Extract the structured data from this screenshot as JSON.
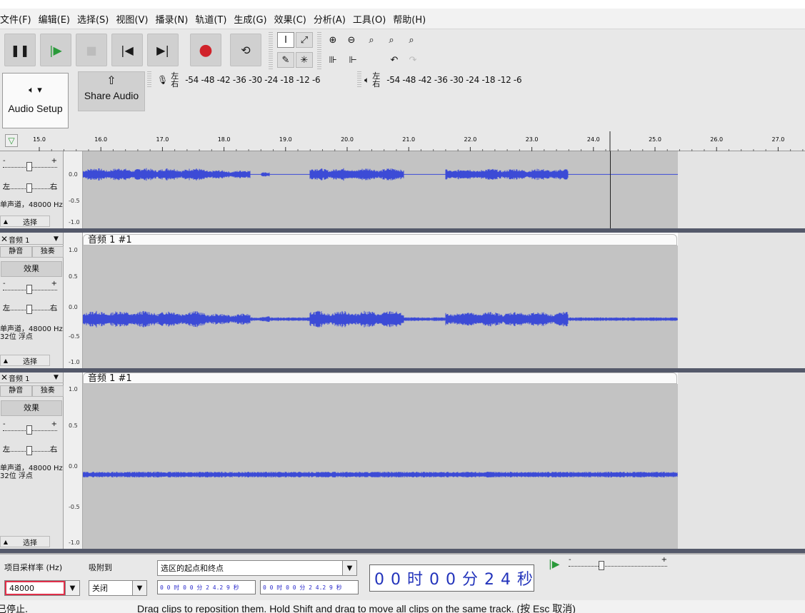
{
  "menu": [
    "文件(F)",
    "编辑(E)",
    "选择(S)",
    "视图(V)",
    "播录(N)",
    "轨道(T)",
    "生成(G)",
    "效果(C)",
    "分析(A)",
    "工具(O)",
    "帮助(H)"
  ],
  "transport": {
    "pause_icon": "pause-icon",
    "play_icon": "play-icon",
    "stop_icon": "stop-icon",
    "skip_start_icon": "skip-to-start-icon",
    "skip_end_icon": "skip-to-end-icon",
    "record_icon": "record-icon",
    "loop_icon": "loop-icon"
  },
  "audio_setup": {
    "label": "Audio Setup"
  },
  "share_audio": {
    "label": "Share Audio"
  },
  "meters": {
    "lr": "左右",
    "scale": "-54 -48 -42 -36 -30 -24 -18 -12 -6"
  },
  "ruler": {
    "ticks": [
      "15.0",
      "16.0",
      "17.0",
      "18.0",
      "19.0",
      "20.0",
      "21.0",
      "22.0",
      "23.0",
      "24.0",
      "25.0",
      "26.0",
      "27.0"
    ]
  },
  "track_common": {
    "left": "左",
    "right": "右",
    "select": "选择",
    "mute": "静音",
    "solo": "独奏",
    "effects": "效果",
    "plus": "+",
    "minus": "-"
  },
  "track0": {
    "info": "单声道，48000 Hz",
    "scale": [
      "0.0",
      "-0.5",
      "-1.0"
    ]
  },
  "track1": {
    "name": "音频 1",
    "clip": "音频 1 #1",
    "info1": "单声道，48000 Hz",
    "info2": "32位 浮点",
    "scale": [
      "1.0",
      "0.5",
      "0.0",
      "-0.5",
      "-1.0"
    ]
  },
  "track2": {
    "name": "音频 1",
    "clip": "音频 1 #1",
    "info1": "单声道，48000 Hz",
    "info2": "32位 浮点",
    "scale": [
      "1.0",
      "0.5",
      "0.0",
      "-0.5",
      "-1.0"
    ]
  },
  "bottom": {
    "rate_label": "项目采样率 (Hz)",
    "rate_value": "48000",
    "snap_label": "吸附到",
    "snap_value": "关闭",
    "selection_label": "选区的起点和终点",
    "time_start": "0 0 时 0 0 分 2 4.2 9 秒",
    "time_end": "0 0 时 0 0 分 2 4.2 9 秒",
    "big_time": "0 0 时 0 0 分 2 4 秒"
  },
  "status": {
    "state": "已停止.",
    "message": "Drag clips to reposition them. Hold Shift and drag to move all clips on the same track.  (按 Esc 取消)"
  }
}
